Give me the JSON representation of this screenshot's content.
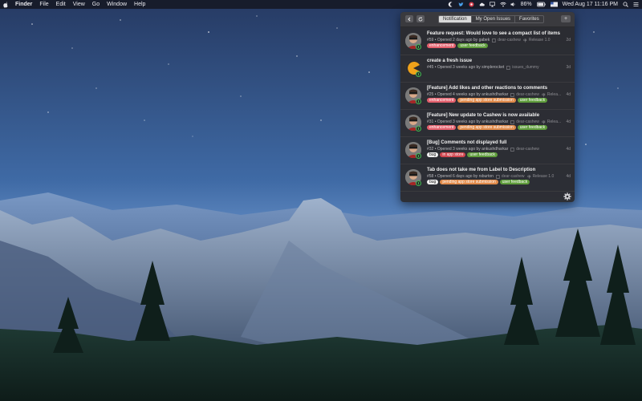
{
  "menubar": {
    "app_name": "Finder",
    "menus": [
      "File",
      "Edit",
      "View",
      "Go",
      "Window",
      "Help"
    ],
    "battery": "86%",
    "clock": "Wed Aug 17  11:16 PM",
    "icons": [
      "cashew-icon",
      "twitter-icon",
      "record-icon",
      "cloud-icon",
      "airplay-icon",
      "wifi-icon",
      "volume-icon",
      "battery-icon",
      "flag-icon",
      "search-icon",
      "list-icon"
    ]
  },
  "panel": {
    "tabs": [
      "Notification",
      "My Open Issues",
      "Favorites"
    ],
    "active_tab": "Notification",
    "plus_label": "+",
    "items": [
      {
        "title": "Feature request: Would love to see a compact list of items",
        "summary": "#59 • Opened 2 days ago by gabek",
        "repo": "dear-cashew",
        "milestone": "Release 1.0",
        "age": "2d",
        "avatar": "avatar-man",
        "labels": [
          {
            "text": "enhancement",
            "color": "#e4606d"
          },
          {
            "text": "user feedback",
            "color": "#5f9d3c"
          }
        ]
      },
      {
        "title": "create a fresh issue",
        "summary": "#45 • Opened 3 weeks ago by simplerocket",
        "repo": "issues_dummy",
        "milestone": "",
        "age": "3d",
        "avatar": "avatar-pac",
        "labels": []
      },
      {
        "title": "[Feature] Add likes and other reactions to comments",
        "summary": "#25 • Opened 4 weeks ago by ankushdharkar",
        "repo": "dear-cashew",
        "milestone": "Relea...",
        "age": "4d",
        "avatar": "avatar-man",
        "labels": [
          {
            "text": "enhancement",
            "color": "#e4606d"
          },
          {
            "text": "pending app store submission",
            "color": "#e08a4a"
          },
          {
            "text": "user feedback",
            "color": "#5f9d3c"
          }
        ]
      },
      {
        "title": "[Feature] New update to Cashew is now available",
        "summary": "#31 • Opened 3 weeks ago by ankushdharkar",
        "repo": "dear-cashew",
        "milestone": "Relea...",
        "age": "4d",
        "avatar": "avatar-man",
        "labels": [
          {
            "text": "enhancement",
            "color": "#e4606d"
          },
          {
            "text": "pending app store submission",
            "color": "#e08a4a"
          },
          {
            "text": "user feedback",
            "color": "#5f9d3c"
          }
        ]
      },
      {
        "title": "[Bug] Comments not displayed full",
        "summary": "#32 • Opened 3 weeks ago by ankushdharkar",
        "repo": "dear-cashew",
        "milestone": "",
        "age": "4d",
        "avatar": "avatar-man",
        "labels": [
          {
            "text": "bug",
            "color": "#f0f0f0",
            "text_color": "#222"
          },
          {
            "text": "in app store",
            "color": "#d0464f"
          },
          {
            "text": "user feedback",
            "color": "#5f9d3c"
          }
        ]
      },
      {
        "title": "Tab does not take me from Label to Description",
        "summary": "#58 • Opened 6 days ago by rsburton",
        "repo": "dear-cashew",
        "milestone": "Release 1.0",
        "age": "4d",
        "avatar": "avatar-man",
        "labels": [
          {
            "text": "bug",
            "color": "#f0f0f0",
            "text_color": "#222"
          },
          {
            "text": "pending app store submission",
            "color": "#e08a4a"
          },
          {
            "text": "user feedback",
            "color": "#5f9d3c"
          }
        ]
      }
    ]
  }
}
